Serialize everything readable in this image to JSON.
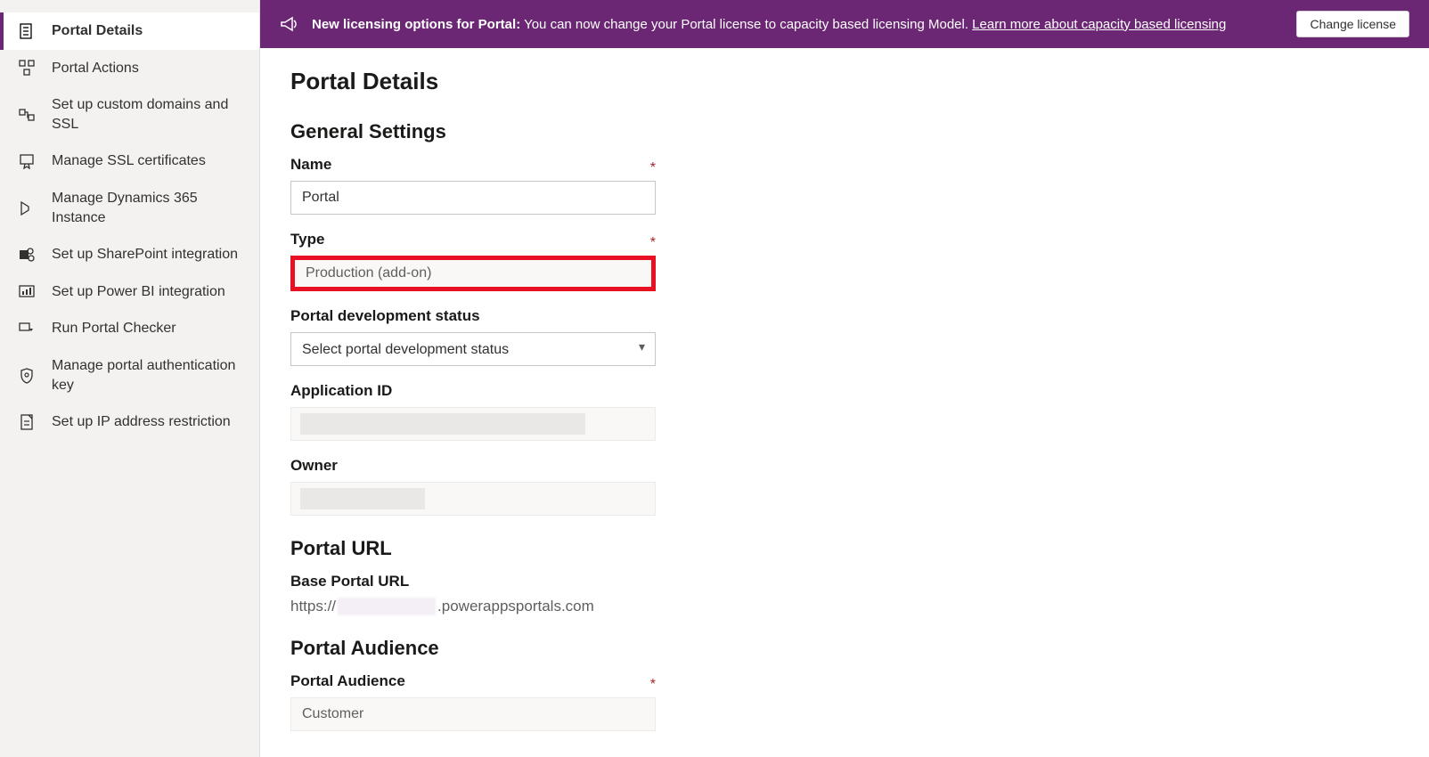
{
  "banner": {
    "prefix": "New licensing options for Portal:",
    "text": " You can now change your Portal license to capacity based licensing Model. ",
    "link": "Learn more about capacity based licensing",
    "button": "Change license"
  },
  "sidebar": {
    "items": [
      {
        "label": "Portal Details",
        "icon": "document"
      },
      {
        "label": "Portal Actions",
        "icon": "actions"
      },
      {
        "label": "Set up custom domains and SSL",
        "icon": "domains"
      },
      {
        "label": "Manage SSL certificates",
        "icon": "cert"
      },
      {
        "label": "Manage Dynamics 365 Instance",
        "icon": "dyn"
      },
      {
        "label": "Set up SharePoint integration",
        "icon": "sp"
      },
      {
        "label": "Set up Power BI integration",
        "icon": "pbi"
      },
      {
        "label": "Run Portal Checker",
        "icon": "checker"
      },
      {
        "label": "Manage portal authentication key",
        "icon": "auth"
      },
      {
        "label": "Set up IP address restriction",
        "icon": "ip"
      }
    ]
  },
  "page": {
    "title": "Portal Details",
    "general_heading": "General Settings",
    "name_label": "Name",
    "name_value": "Portal",
    "type_label": "Type",
    "type_value": "Production (add-on)",
    "status_label": "Portal development status",
    "status_placeholder": "Select portal development status",
    "appid_label": "Application ID",
    "owner_label": "Owner",
    "url_heading": "Portal URL",
    "baseurl_label": "Base Portal URL",
    "baseurl_prefix": "https://",
    "baseurl_suffix": ".powerappsportals.com",
    "audience_heading": "Portal Audience",
    "audience_label": "Portal Audience",
    "audience_value": "Customer"
  }
}
